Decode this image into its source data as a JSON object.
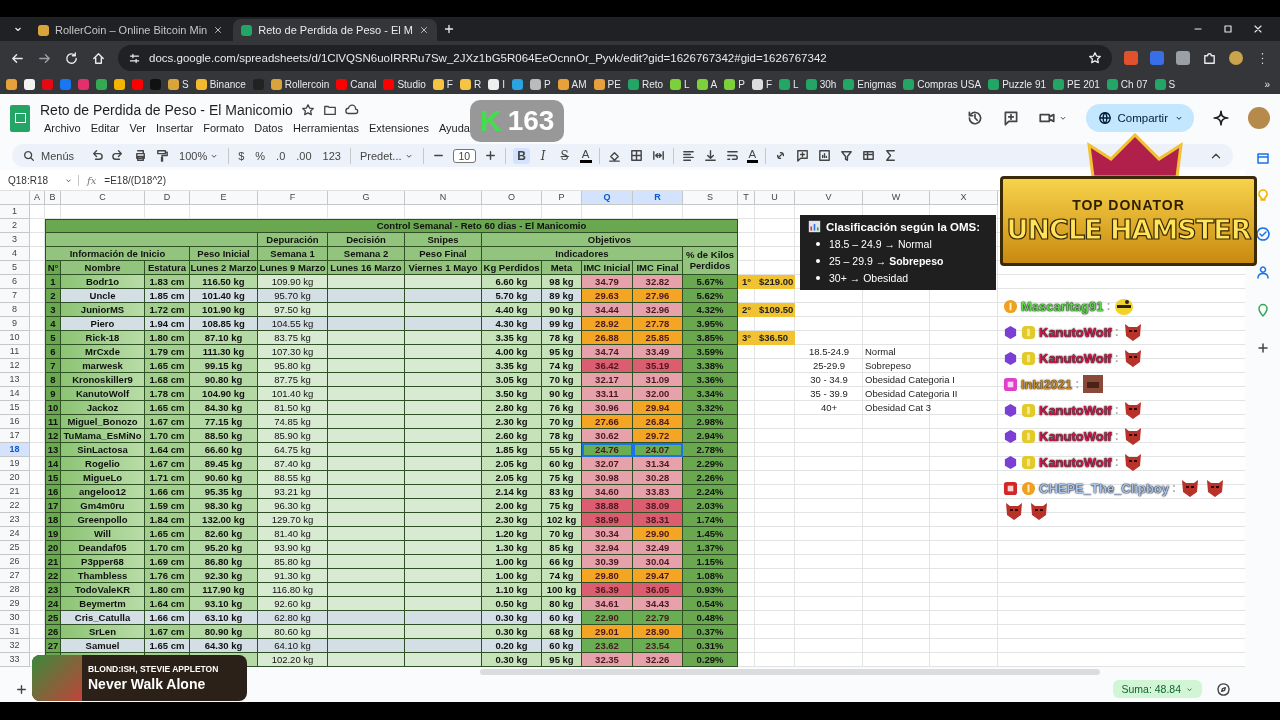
{
  "browser": {
    "tabs": [
      {
        "title": "RollerCoin – Online Bitcoin Min",
        "color": "#d9a43b",
        "selected": false
      },
      {
        "title": "Reto de Perdida de Peso - El M",
        "color": "#23a566",
        "selected": true
      }
    ],
    "url": "docs.google.com/spreadsheets/d/1ClVQSN6uoIRRRu7Sw_2JXz1bG5R064EeOcnnOr_Pyvk/edit?gid=1626767342#gid=1626767342",
    "bookmarks": [
      {
        "color": "#e8a13a"
      },
      {
        "color": "#f2f2f2"
      },
      {
        "color": "#e50914"
      },
      {
        "color": "#1877f2"
      },
      {
        "color": "#e1306c"
      },
      {
        "color": "#34a853"
      },
      {
        "color": "#f4b400"
      },
      {
        "color": "#ff0000"
      },
      {
        "color": "#111111"
      },
      {
        "label": "S",
        "color": "#d9a43b"
      },
      {
        "label": "Binance",
        "color": "#f3ba2f"
      },
      {
        "color": "#222222"
      },
      {
        "label": "Rollercoin",
        "color": "#d9a43b"
      },
      {
        "label": "Canal",
        "color": "#ff0000"
      },
      {
        "label": "Studio",
        "color": "#ff0000"
      },
      {
        "label": "F",
        "color": "#f5c542"
      },
      {
        "label": "R",
        "color": "#f5c542"
      },
      {
        "label": "I",
        "color": "#eeeeee"
      },
      {
        "color": "#2aa3e0"
      },
      {
        "label": "P",
        "color": "#bbbbbb"
      },
      {
        "label": "AM",
        "color": "#e8a13a"
      },
      {
        "label": "PE",
        "color": "#e8a13a"
      },
      {
        "label": "Reto",
        "color": "#23a566"
      },
      {
        "label": "L",
        "color": "#7cd13a"
      },
      {
        "label": "A",
        "color": "#7cd13a"
      },
      {
        "label": "P",
        "color": "#7cd13a"
      },
      {
        "label": "F",
        "color": "#dddddd"
      },
      {
        "label": "L",
        "color": "#23a566"
      },
      {
        "label": "30h",
        "color": "#23a566"
      },
      {
        "label": "Enigmas",
        "color": "#23a566"
      },
      {
        "label": "Compras USA",
        "color": "#23a566"
      },
      {
        "label": "Puzzle 91",
        "color": "#23a566"
      },
      {
        "label": "PE 201",
        "color": "#23a566"
      },
      {
        "label": "Ch 07",
        "color": "#23a566"
      },
      {
        "label": "S",
        "color": "#23a566"
      }
    ],
    "more": "»"
  },
  "doc": {
    "title": "Reto de Perdida de Peso - El Manicomio",
    "menu": [
      "Archivo",
      "Editar",
      "Ver",
      "Insertar",
      "Formato",
      "Datos",
      "Herramientas",
      "Extensiones",
      "Ayuda"
    ],
    "share": "Compartir"
  },
  "toolbar": [
    {
      "kind": "search",
      "label": "Menús"
    },
    {
      "kind": "undo"
    },
    {
      "kind": "redo"
    },
    {
      "kind": "print"
    },
    {
      "kind": "paint-format"
    },
    {
      "kind": "dropdown",
      "label": "100%"
    },
    {
      "kind": "separator"
    },
    {
      "kind": "text",
      "label": "$"
    },
    {
      "kind": "text",
      "label": "%"
    },
    {
      "kind": "text",
      "label": ".0"
    },
    {
      "kind": "text",
      "label": ".00"
    },
    {
      "kind": "text",
      "label": "123"
    },
    {
      "kind": "separator"
    },
    {
      "kind": "dropdown",
      "label": "Predet..."
    },
    {
      "kind": "separator"
    },
    {
      "kind": "minus"
    },
    {
      "kind": "field",
      "label": "10"
    },
    {
      "kind": "plus"
    },
    {
      "kind": "separator"
    },
    {
      "kind": "bold",
      "label": "B",
      "on": true
    },
    {
      "kind": "italic",
      "label": "I",
      "on": false
    },
    {
      "kind": "strike",
      "label": "S",
      "on": false
    },
    {
      "kind": "text-color",
      "label": "A"
    },
    {
      "kind": "separator"
    },
    {
      "kind": "fill"
    },
    {
      "kind": "borders"
    },
    {
      "kind": "merge"
    },
    {
      "kind": "separator"
    },
    {
      "kind": "align"
    },
    {
      "kind": "valign"
    },
    {
      "kind": "wrap"
    },
    {
      "kind": "text-color",
      "label": "A"
    },
    {
      "kind": "separator"
    },
    {
      "kind": "link"
    },
    {
      "kind": "comment"
    },
    {
      "kind": "chart"
    },
    {
      "kind": "filter"
    },
    {
      "kind": "table"
    },
    {
      "kind": "sigma"
    }
  ],
  "formula_bar": {
    "range": "Q18:R18",
    "fx": "fx",
    "formula": "=E18/(D18^2)"
  },
  "columns": [
    {
      "label": "A",
      "selected": false
    },
    {
      "label": "B",
      "selected": false
    },
    {
      "label": "C",
      "selected": false
    },
    {
      "label": "D",
      "selected": false
    },
    {
      "label": "E",
      "selected": false
    },
    {
      "label": "F",
      "selected": false
    },
    {
      "label": "G",
      "selected": false
    },
    {
      "label": "N",
      "selected": false
    },
    {
      "label": "O",
      "selected": false
    },
    {
      "label": "P",
      "selected": false
    },
    {
      "label": "Q",
      "selected": true
    },
    {
      "label": "R",
      "selected": true
    },
    {
      "label": "S",
      "selected": false
    },
    {
      "label": "T",
      "selected": false
    },
    {
      "label": "U",
      "selected": false
    },
    {
      "label": "V",
      "selected": false
    },
    {
      "label": "W",
      "selected": false
    },
    {
      "label": "X",
      "selected": false
    }
  ],
  "row_numbers": [
    {
      "label": "1",
      "selected": false
    },
    {
      "label": "2",
      "selected": false
    },
    {
      "label": "3",
      "selected": false
    },
    {
      "label": "4",
      "selected": false
    },
    {
      "label": "5",
      "selected": false
    },
    {
      "label": "6",
      "selected": false
    },
    {
      "label": "7",
      "selected": false
    },
    {
      "label": "8",
      "selected": false
    },
    {
      "label": "9",
      "selected": false
    },
    {
      "label": "10",
      "selected": false
    },
    {
      "label": "11",
      "selected": false
    },
    {
      "label": "12",
      "selected": false
    },
    {
      "label": "13",
      "selected": false
    },
    {
      "label": "14",
      "selected": false
    },
    {
      "label": "15",
      "selected": false
    },
    {
      "label": "16",
      "selected": false
    },
    {
      "label": "17",
      "selected": false
    },
    {
      "label": "18",
      "selected": true
    },
    {
      "label": "19",
      "selected": false
    },
    {
      "label": "20",
      "selected": false
    },
    {
      "label": "21",
      "selected": false
    },
    {
      "label": "22",
      "selected": false
    },
    {
      "label": "23",
      "selected": false
    },
    {
      "label": "24",
      "selected": false
    },
    {
      "label": "25",
      "selected": false
    },
    {
      "label": "26",
      "selected": false
    },
    {
      "label": "27",
      "selected": false
    },
    {
      "label": "28",
      "selected": false
    },
    {
      "label": "29",
      "selected": false
    },
    {
      "label": "30",
      "selected": false
    },
    {
      "label": "31",
      "selected": false
    },
    {
      "label": "32",
      "selected": false
    },
    {
      "label": "33",
      "selected": false
    }
  ],
  "table": {
    "title": "Control Semanal - Reto 60 dias - El Manicomio",
    "header_row_1": [
      "Depuración",
      "Decisión",
      "Snipes",
      "Objetivos"
    ],
    "header_row_2": [
      "Información de Inicio",
      "Peso Inicial",
      "Semana 1",
      "Semana 2",
      "Peso Final",
      "Indicadores",
      "% de Kilos Perdidos"
    ],
    "header_row_3": [
      "N°",
      "Nombre",
      "Estatura",
      "Lunes 2 Marzo",
      "Lunes 9 Marzo",
      "Lunes 16 Marzo",
      "Viernes 1 Mayo",
      "Kg Perdidos",
      "Meta",
      "IMC Inicial",
      "IMC Final"
    ]
  },
  "participants": [
    {
      "n": "1",
      "name": "Bodr1o",
      "height": "1.83 cm",
      "start": "116.50 kg",
      "week1": "109.90 kg",
      "lost": "6.60 kg",
      "goal": "98 kg",
      "bmi_start": {
        "value": "34.79",
        "color": "#e6a1aa"
      },
      "bmi_end": {
        "value": "32.82",
        "color": "#e6a1aa"
      },
      "pct": "5.67%",
      "shaded": false,
      "selected": false,
      "prize": {
        "place": "1°",
        "amount": "$219.00"
      }
    },
    {
      "n": "2",
      "name": "Uncle",
      "height": "1.85 cm",
      "start": "101.40 kg",
      "week1": "95.70 kg",
      "lost": "5.70 kg",
      "goal": "89 kg",
      "bmi_start": {
        "value": "29.63",
        "color": "#f5a524"
      },
      "bmi_end": {
        "value": "27.96",
        "color": "#f5a524"
      },
      "pct": "5.62%",
      "shaded": true,
      "selected": false
    },
    {
      "n": "3",
      "name": "JuniorMS",
      "height": "1.72 cm",
      "start": "101.90 kg",
      "week1": "97.50 kg",
      "lost": "4.40 kg",
      "goal": "90 kg",
      "bmi_start": {
        "value": "34.44",
        "color": "#e6a1aa"
      },
      "bmi_end": {
        "value": "32.96",
        "color": "#e6a1aa"
      },
      "pct": "4.32%",
      "shaded": false,
      "selected": false,
      "prize": {
        "place": "2°",
        "amount": "$109.50"
      }
    },
    {
      "n": "4",
      "name": "Piero",
      "height": "1.94 cm",
      "start": "108.85 kg",
      "week1": "104.55 kg",
      "lost": "4.30 kg",
      "goal": "99 kg",
      "bmi_start": {
        "value": "28.92",
        "color": "#f5a524"
      },
      "bmi_end": {
        "value": "27.78",
        "color": "#f5a524"
      },
      "pct": "3.95%",
      "shaded": true,
      "selected": false
    },
    {
      "n": "5",
      "name": "Rick-18",
      "height": "1.80 cm",
      "start": "87.10 kg",
      "week1": "83.75 kg",
      "lost": "3.35 kg",
      "goal": "78 kg",
      "bmi_start": {
        "value": "26.88",
        "color": "#f5a524"
      },
      "bmi_end": {
        "value": "25.85",
        "color": "#f5a524"
      },
      "pct": "3.85%",
      "shaded": false,
      "selected": false,
      "prize": {
        "place": "3°",
        "amount": "$36.50"
      }
    },
    {
      "n": "6",
      "name": "MrCxde",
      "height": "1.79 cm",
      "start": "111.30 kg",
      "week1": "107.30 kg",
      "lost": "4.00 kg",
      "goal": "95 kg",
      "bmi_start": {
        "value": "34.74",
        "color": "#e6a1aa"
      },
      "bmi_end": {
        "value": "33.49",
        "color": "#e6a1aa"
      },
      "pct": "3.59%",
      "shaded": false,
      "selected": false
    },
    {
      "n": "7",
      "name": "marwesk",
      "height": "1.65 cm",
      "start": "99.15 kg",
      "week1": "95.80 kg",
      "lost": "3.35 kg",
      "goal": "74 kg",
      "bmi_start": {
        "value": "36.42",
        "color": "#dc5d6f"
      },
      "bmi_end": {
        "value": "35.19",
        "color": "#dc5d6f"
      },
      "pct": "3.38%",
      "shaded": false,
      "selected": false
    },
    {
      "n": "8",
      "name": "Kronoskiller9",
      "height": "1.68 cm",
      "start": "90.80 kg",
      "week1": "87.75 kg",
      "lost": "3.05 kg",
      "goal": "70 kg",
      "bmi_start": {
        "value": "32.17",
        "color": "#e6a1aa"
      },
      "bmi_end": {
        "value": "31.09",
        "color": "#e6a1aa"
      },
      "pct": "3.36%",
      "shaded": false,
      "selected": false
    },
    {
      "n": "9",
      "name": "KanutoWolf",
      "height": "1.78 cm",
      "start": "104.90 kg",
      "week1": "101.40 kg",
      "lost": "3.50 kg",
      "goal": "90 kg",
      "bmi_start": {
        "value": "33.11",
        "color": "#e6a1aa"
      },
      "bmi_end": {
        "value": "32.00",
        "color": "#e6a1aa"
      },
      "pct": "3.34%",
      "shaded": false,
      "selected": false
    },
    {
      "n": "10",
      "name": "Jackoz",
      "height": "1.65 cm",
      "start": "84.30 kg",
      "week1": "81.50 kg",
      "lost": "2.80 kg",
      "goal": "76 kg",
      "bmi_start": {
        "value": "30.96",
        "color": "#e6a1aa"
      },
      "bmi_end": {
        "value": "29.94",
        "color": "#f5a524"
      },
      "pct": "3.32%",
      "shaded": false,
      "selected": false
    },
    {
      "n": "11",
      "name": "Miguel_Bonozo",
      "height": "1.67 cm",
      "start": "77.15 kg",
      "week1": "74.85 kg",
      "lost": "2.30 kg",
      "goal": "70 kg",
      "bmi_start": {
        "value": "27.66",
        "color": "#f5a524"
      },
      "bmi_end": {
        "value": "26.84",
        "color": "#f5a524"
      },
      "pct": "2.98%",
      "shaded": false,
      "selected": false
    },
    {
      "n": "12",
      "name": "TuMama_EsMiNo",
      "height": "1.70 cm",
      "start": "88.50 kg",
      "week1": "85.90 kg",
      "lost": "2.60 kg",
      "goal": "78 kg",
      "bmi_start": {
        "value": "30.62",
        "color": "#e6a1aa"
      },
      "bmi_end": {
        "value": "29.72",
        "color": "#f5a524"
      },
      "pct": "2.94%",
      "shaded": false,
      "selected": false
    },
    {
      "n": "13",
      "name": "SinLactosa",
      "height": "1.64 cm",
      "start": "66.60 kg",
      "week1": "64.75 kg",
      "lost": "1.85 kg",
      "goal": "55 kg",
      "bmi_start": {
        "value": "24.76",
        "color": "#6aae53"
      },
      "bmi_end": {
        "value": "24.07",
        "color": "#6aae53"
      },
      "pct": "2.78%",
      "shaded": false,
      "selected": true
    },
    {
      "n": "14",
      "name": "Rogelio",
      "height": "1.67 cm",
      "start": "89.45 kg",
      "week1": "87.40 kg",
      "lost": "2.05 kg",
      "goal": "60 kg",
      "bmi_start": {
        "value": "32.07",
        "color": "#e6a1aa"
      },
      "bmi_end": {
        "value": "31.34",
        "color": "#e6a1aa"
      },
      "pct": "2.29%",
      "shaded": false,
      "selected": false
    },
    {
      "n": "15",
      "name": "MigueLo",
      "height": "1.71 cm",
      "start": "90.60 kg",
      "week1": "88.55 kg",
      "lost": "2.05 kg",
      "goal": "75 kg",
      "bmi_start": {
        "value": "30.98",
        "color": "#e6a1aa"
      },
      "bmi_end": {
        "value": "30.28",
        "color": "#e6a1aa"
      },
      "pct": "2.26%",
      "shaded": false,
      "selected": false
    },
    {
      "n": "16",
      "name": "angeloo12",
      "height": "1.66 cm",
      "start": "95.35 kg",
      "week1": "93.21 kg",
      "lost": "2.14 kg",
      "goal": "83 kg",
      "bmi_start": {
        "value": "34.60",
        "color": "#e6a1aa"
      },
      "bmi_end": {
        "value": "33.83",
        "color": "#e6a1aa"
      },
      "pct": "2.24%",
      "shaded": false,
      "selected": false
    },
    {
      "n": "17",
      "name": "Gm4m0ru",
      "height": "1.59 cm",
      "start": "98.30 kg",
      "week1": "96.30 kg",
      "lost": "2.00 kg",
      "goal": "75 kg",
      "bmi_start": {
        "value": "38.88",
        "color": "#dc5d6f"
      },
      "bmi_end": {
        "value": "38.09",
        "color": "#dc5d6f"
      },
      "pct": "2.03%",
      "shaded": false,
      "selected": false
    },
    {
      "n": "18",
      "name": "Greenpollo",
      "height": "1.84 cm",
      "start": "132.00 kg",
      "week1": "129.70 kg",
      "lost": "2.30 kg",
      "goal": "102 kg",
      "bmi_start": {
        "value": "38.99",
        "color": "#dc5d6f"
      },
      "bmi_end": {
        "value": "38.31",
        "color": "#dc5d6f"
      },
      "pct": "1.74%",
      "shaded": false,
      "selected": false
    },
    {
      "n": "19",
      "name": "Will",
      "height": "1.65 cm",
      "start": "82.60 kg",
      "week1": "81.40 kg",
      "lost": "1.20 kg",
      "goal": "70 kg",
      "bmi_start": {
        "value": "30.34",
        "color": "#e6a1aa"
      },
      "bmi_end": {
        "value": "29.90",
        "color": "#f5a524"
      },
      "pct": "1.45%",
      "shaded": false,
      "selected": false
    },
    {
      "n": "20",
      "name": "Deandaf05",
      "height": "1.70 cm",
      "start": "95.20 kg",
      "week1": "93.90 kg",
      "lost": "1.30 kg",
      "goal": "85 kg",
      "bmi_start": {
        "value": "32.94",
        "color": "#e6a1aa"
      },
      "bmi_end": {
        "value": "32.49",
        "color": "#e6a1aa"
      },
      "pct": "1.37%",
      "shaded": false,
      "selected": false
    },
    {
      "n": "21",
      "name": "P3pper68",
      "height": "1.69 cm",
      "start": "86.80 kg",
      "week1": "85.80 kg",
      "lost": "1.00 kg",
      "goal": "66 kg",
      "bmi_start": {
        "value": "30.39",
        "color": "#e6a1aa"
      },
      "bmi_end": {
        "value": "30.04",
        "color": "#e6a1aa"
      },
      "pct": "1.15%",
      "shaded": false,
      "selected": false
    },
    {
      "n": "22",
      "name": "Thambless",
      "height": "1.76 cm",
      "start": "92.30 kg",
      "week1": "91.30 kg",
      "lost": "1.00 kg",
      "goal": "74 kg",
      "bmi_start": {
        "value": "29.80",
        "color": "#f5a524"
      },
      "bmi_end": {
        "value": "29.47",
        "color": "#f5a524"
      },
      "pct": "1.08%",
      "shaded": false,
      "selected": false
    },
    {
      "n": "23",
      "name": "TodoValeKR",
      "height": "1.80 cm",
      "start": "117.90 kg",
      "week1": "116.80 kg",
      "lost": "1.10 kg",
      "goal": "100 kg",
      "bmi_start": {
        "value": "36.39",
        "color": "#dc5d6f"
      },
      "bmi_end": {
        "value": "36.05",
        "color": "#dc5d6f"
      },
      "pct": "0.93%",
      "shaded": false,
      "selected": false
    },
    {
      "n": "24",
      "name": "Beymertm",
      "height": "1.64 cm",
      "start": "93.10 kg",
      "week1": "92.60 kg",
      "lost": "0.50 kg",
      "goal": "80 kg",
      "bmi_start": {
        "value": "34.61",
        "color": "#e6a1aa"
      },
      "bmi_end": {
        "value": "34.43",
        "color": "#e6a1aa"
      },
      "pct": "0.54%",
      "shaded": false,
      "selected": false
    },
    {
      "n": "25",
      "name": "Cris_Catulla",
      "height": "1.66 cm",
      "start": "63.10 kg",
      "week1": "62.80 kg",
      "lost": "0.30 kg",
      "goal": "60 kg",
      "bmi_start": {
        "value": "22.90",
        "color": "#6aae53"
      },
      "bmi_end": {
        "value": "22.79",
        "color": "#6aae53"
      },
      "pct": "0.48%",
      "shaded": true,
      "selected": false
    },
    {
      "n": "26",
      "name": "SrLen",
      "height": "1.67 cm",
      "start": "80.90 kg",
      "week1": "80.60 kg",
      "lost": "0.30 kg",
      "goal": "68 kg",
      "bmi_start": {
        "value": "29.01",
        "color": "#f5a524"
      },
      "bmi_end": {
        "value": "28.90",
        "color": "#f5a524"
      },
      "pct": "0.37%",
      "shaded": false,
      "selected": false
    },
    {
      "n": "27",
      "name": "Samuel",
      "height": "1.65 cm",
      "start": "64.30 kg",
      "week1": "64.10 kg",
      "lost": "0.20 kg",
      "goal": "60 kg",
      "bmi_start": {
        "value": "23.62",
        "color": "#6aae53"
      },
      "bmi_end": {
        "value": "23.54",
        "color": "#6aae53"
      },
      "pct": "0.31%",
      "shaded": true,
      "selected": false
    },
    {
      "week1": "102.20 kg",
      "lost": "0.30 kg",
      "goal": "95 kg",
      "bmi_start": {
        "value": "32.35",
        "color": "#e6a1aa"
      },
      "bmi_end": {
        "value": "32.26",
        "color": "#e6a1aa"
      },
      "pct": "0.29%",
      "shaded": false,
      "selected": false
    }
  ],
  "classification": [
    {
      "range": "18.5-24.9",
      "label": "Normal"
    },
    {
      "range": "25-29.9",
      "label": "Sobrepeso"
    },
    {
      "range": "30 - 34.9",
      "label": "Obesidad Categoria I"
    },
    {
      "range": "35 - 39.9",
      "label": "Obesidad Categoria II"
    },
    {
      "range": "40+",
      "label": "Obesidad Cat 3"
    }
  ],
  "oms_note": {
    "title": "Clasificación según la OMS:",
    "items": [
      "18.5 – 24.9 → Normal",
      "25 – 29.9 → **Sobrepeso**",
      "30+ → Obesidad"
    ]
  },
  "status_bar": {
    "sum": "Suma: 48.84"
  },
  "stream": {
    "badge": {
      "logo": "K",
      "count": "163"
    },
    "donator": {
      "subtitle": "TOP DONATOR",
      "name": "UNCLE HAMSTER"
    },
    "chat": [
      {
        "user": "Mascaritag91",
        "color": "#5ed84a",
        "sep": ":",
        "badges": [
          {
            "kind": "medal"
          }
        ],
        "emotes": [
          {
            "kind": "bee"
          }
        ]
      },
      {
        "user": "KanutoWolf",
        "color": "#c8194b",
        "sep": ":",
        "badges": [
          {
            "kind": "gem"
          },
          {
            "kind": "coin"
          }
        ],
        "emotes": [
          {
            "kind": "demon"
          }
        ]
      },
      {
        "user": "KanutoWolf",
        "color": "#c8194b",
        "sep": ":",
        "badges": [
          {
            "kind": "gem"
          },
          {
            "kind": "coin"
          }
        ],
        "emotes": [
          {
            "kind": "demon"
          }
        ]
      },
      {
        "user": "Inki2021",
        "color": "#c98a2c",
        "sep": ":",
        "badges": [
          {
            "kind": "sub"
          }
        ],
        "emotes": [
          {
            "kind": "photo"
          }
        ]
      },
      {
        "user": "KanutoWolf",
        "color": "#c8194b",
        "sep": ":",
        "badges": [
          {
            "kind": "gem"
          },
          {
            "kind": "coin"
          }
        ],
        "emotes": [
          {
            "kind": "demon"
          }
        ]
      },
      {
        "user": "KanutoWolf",
        "color": "#c8194b",
        "sep": ":",
        "badges": [
          {
            "kind": "gem"
          },
          {
            "kind": "coin"
          }
        ],
        "emotes": [
          {
            "kind": "demon"
          }
        ]
      },
      {
        "user": "KanutoWolf",
        "color": "#c8194b",
        "sep": ":",
        "badges": [
          {
            "kind": "gem"
          },
          {
            "kind": "coin"
          }
        ],
        "emotes": [
          {
            "kind": "demon"
          }
        ]
      },
      {
        "user": "CHEPE_The_Clipboy",
        "color": "#a8c4ea",
        "sep": ":",
        "badges": [
          {
            "kind": "vip"
          },
          {
            "kind": "medal"
          }
        ],
        "emotes": [
          {
            "kind": "demon"
          },
          {
            "kind": "demon"
          },
          {
            "kind": "demon"
          },
          {
            "kind": "demon"
          }
        ]
      }
    ],
    "now_playing": {
      "artist": "BLOND:ISH, STEVIE APPLETON",
      "title": "Never Walk Alone"
    }
  }
}
